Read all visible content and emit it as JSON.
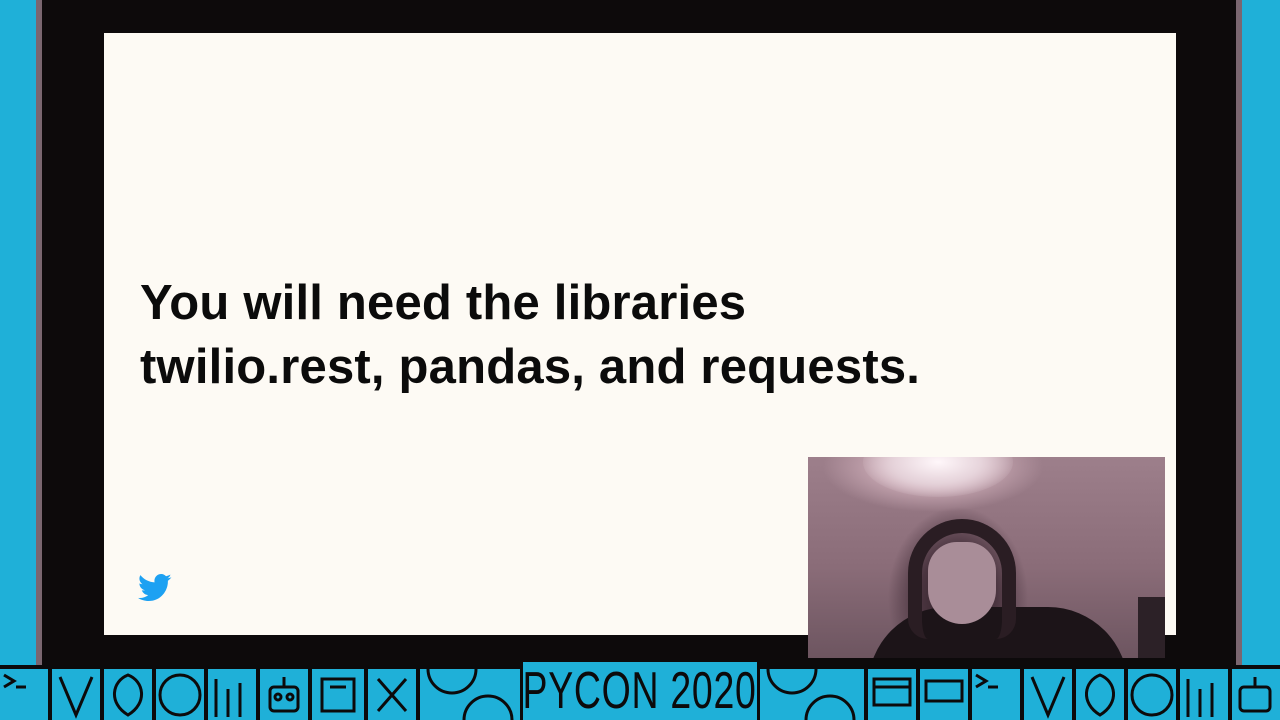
{
  "slide": {
    "lines": [
      "You will need the libraries",
      "twilio.rest, pandas, and requests."
    ],
    "logo_icon": "twitter-bird-icon"
  },
  "webcam": {
    "description_icon": "presenter-webcam"
  },
  "banner": {
    "title": "PYCON 2020"
  },
  "colors": {
    "accent_blue": "#1fb0d8",
    "slide_background": "#fdfaf4",
    "frame_dark": "#0d0a0b",
    "twitter_blue": "#1da1f2"
  }
}
